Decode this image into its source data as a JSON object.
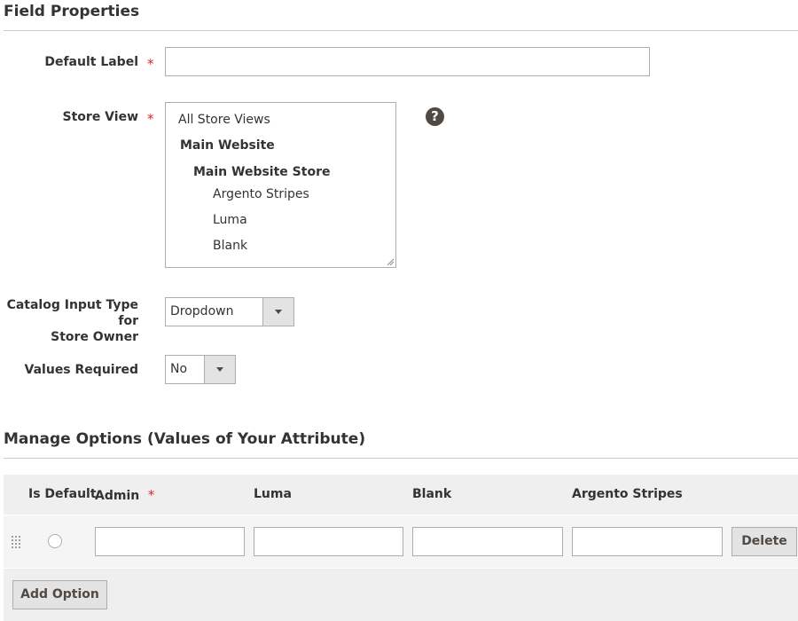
{
  "field_properties": {
    "title": "Field Properties",
    "default_label": {
      "label": "Default Label",
      "value": ""
    },
    "store_view": {
      "label": "Store View",
      "options": [
        {
          "text": "All Store Views",
          "level": "top"
        },
        {
          "text": "Main Website",
          "level": "website"
        },
        {
          "text": "Main Website Store",
          "level": "store"
        },
        {
          "text": "Argento Stripes",
          "level": "view"
        },
        {
          "text": "Luma",
          "level": "view"
        },
        {
          "text": "Blank",
          "level": "view"
        }
      ],
      "help_glyph": "?"
    },
    "input_type": {
      "label_line1": "Catalog Input Type for",
      "label_line2": "Store Owner",
      "value": "Dropdown"
    },
    "values_required": {
      "label": "Values Required",
      "value": "No"
    }
  },
  "manage_options": {
    "title": "Manage Options (Values of Your Attribute)",
    "columns": [
      "Is Default",
      "Admin",
      "Luma",
      "Blank",
      "Argento Stripes"
    ],
    "rows": [
      {
        "is_default": false,
        "admin": "",
        "luma": "",
        "blank": "",
        "argento_stripes": ""
      }
    ],
    "delete_label": "Delete",
    "add_option_label": "Add Option"
  },
  "icons": {
    "help": "help-icon",
    "drag": "drag-handle-icon",
    "dropdown": "chevron-down-icon"
  },
  "colors": {
    "required": "#e22626",
    "text": "#333333",
    "border": "#adadad",
    "button_bg": "#e3e3e3",
    "grid_header_bg": "#efefef",
    "help_icon_bg": "#514943"
  }
}
